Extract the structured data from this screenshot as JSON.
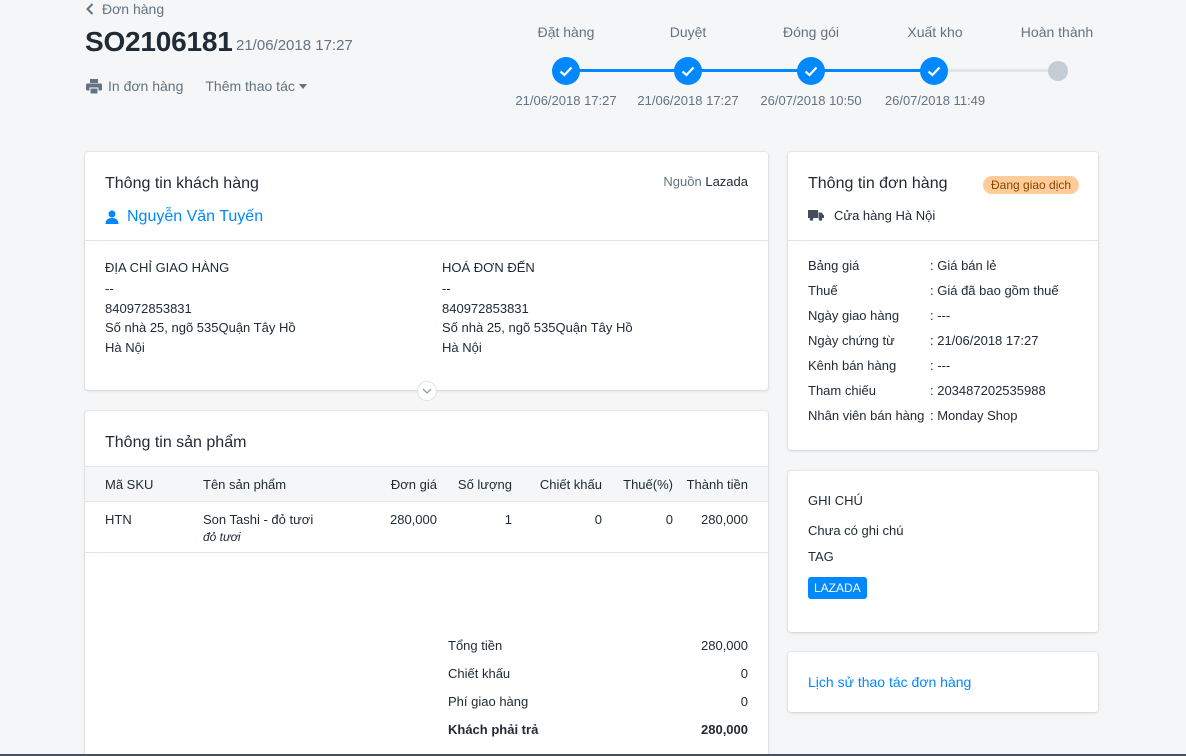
{
  "header": {
    "back_label": "Đơn hàng",
    "order_code": "SO2106181",
    "order_date": "21/06/2018 17:27",
    "print_label": "In đơn hàng",
    "more_label": "Thêm thao tác"
  },
  "stepper": {
    "steps": [
      {
        "label": "Đặt hàng",
        "date": "21/06/2018 17:27",
        "done": true
      },
      {
        "label": "Duyệt",
        "date": "21/06/2018 17:27",
        "done": true
      },
      {
        "label": "Đóng gói",
        "date": "26/07/2018 10:50",
        "done": true
      },
      {
        "label": "Xuất kho",
        "date": "26/07/2018 11:49",
        "done": true
      },
      {
        "label": "Hoàn thành",
        "date": "",
        "done": false
      }
    ],
    "active_color": "#0088ff",
    "pending_color": "#c4cdd5"
  },
  "customer": {
    "title": "Thông tin khách hàng",
    "source_prefix": "Nguồn",
    "source": "Lazada",
    "name": "Nguyễn Văn Tuyến",
    "shipping": {
      "heading": "ĐỊA CHỈ GIAO HÀNG",
      "line1": "--",
      "phone": "840972853831",
      "address": "Số nhà 25, ngõ 535Quận Tây Hồ",
      "city": "Hà Nội"
    },
    "billing": {
      "heading": "HOÁ ĐƠN ĐẾN",
      "line1": "--",
      "phone": "840972853831",
      "address": "Số nhà 25, ngõ 535Quận Tây Hồ",
      "city": "Hà Nội"
    }
  },
  "products": {
    "title": "Thông tin sản phẩm",
    "columns": [
      "Mã SKU",
      "Tên sản phẩm",
      "Đơn giá",
      "Số lượng",
      "Chiết khấu",
      "Thuế(%)",
      "Thành tiền"
    ],
    "rows": [
      {
        "sku": "HTN",
        "name": "Son Tashi - đỏ tươi",
        "variant": "đỏ tươi",
        "price": "280,000",
        "qty": "1",
        "discount": "0",
        "tax": "0",
        "total": "280,000"
      }
    ],
    "summary": {
      "subtotal_label": "Tổng tiền",
      "subtotal": "280,000",
      "discount_label": "Chiết khấu",
      "discount": "0",
      "shipping_label": "Phí giao hàng",
      "shipping": "0",
      "due_label": "Khách phải trả",
      "due": "280,000"
    }
  },
  "order_info": {
    "title": "Thông tin đơn hàng",
    "status": "Đang giao dịch",
    "store": "Cửa hàng Hà Nội",
    "fields": [
      {
        "label": "Bảng giá",
        "value": ": Giá bán lẻ"
      },
      {
        "label": "Thuế",
        "value": ": Giá đã bao gồm thuế"
      },
      {
        "label": "Ngày giao hàng",
        "value": ": ---"
      },
      {
        "label": "Ngày chứng từ",
        "value": ": 21/06/2018 17:27"
      },
      {
        "label": "Kênh bán hàng",
        "value": ": ---"
      },
      {
        "label": "Tham chiếu",
        "value": ": 203487202535988"
      },
      {
        "label": "Nhân viên bán hàng",
        "value": ": Monday Shop"
      }
    ]
  },
  "notes": {
    "note_heading": "GHI CHÚ",
    "note_text": "Chưa có ghi chú",
    "tag_heading": "TAG",
    "tags": [
      "LAZADA"
    ]
  },
  "history": {
    "link_label": "Lịch sử thao tác đơn hàng"
  }
}
